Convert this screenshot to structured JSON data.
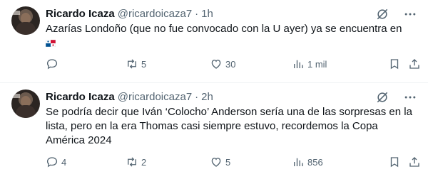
{
  "tweets": [
    {
      "author_name": "Ricardo Icaza",
      "handle": "@ricardoicaza7",
      "separator": "·",
      "time": "1h",
      "text": "Azarías Londoño (que no fue convocado con la U ayer) ya se encuentra en",
      "flag": "panama-flag",
      "replies": "",
      "reposts": "5",
      "likes": "30",
      "views": "1 mil"
    },
    {
      "author_name": "Ricardo Icaza",
      "handle": "@ricardoicaza7",
      "separator": "·",
      "time": "2h",
      "text": "Se podría decir que Iván ‘Colocho’ Anderson sería una de las sorpresas en la lista, pero en la era Thomas casi siempre estuvo, recordemos la Copa América 2024",
      "replies": "4",
      "reposts": "2",
      "likes": "5",
      "views": "856"
    }
  ],
  "icons": {
    "reply": "reply-icon",
    "repost": "repost-icon",
    "like": "heart-icon",
    "views": "views-icon",
    "bookmark": "bookmark-icon",
    "share": "share-icon",
    "grok": "grok-icon",
    "more": "more-icon"
  },
  "colors": {
    "text": "#0f1419",
    "secondary": "#536471",
    "divider": "#eff3f4",
    "panama_red": "#d21034",
    "panama_blue": "#005293"
  }
}
